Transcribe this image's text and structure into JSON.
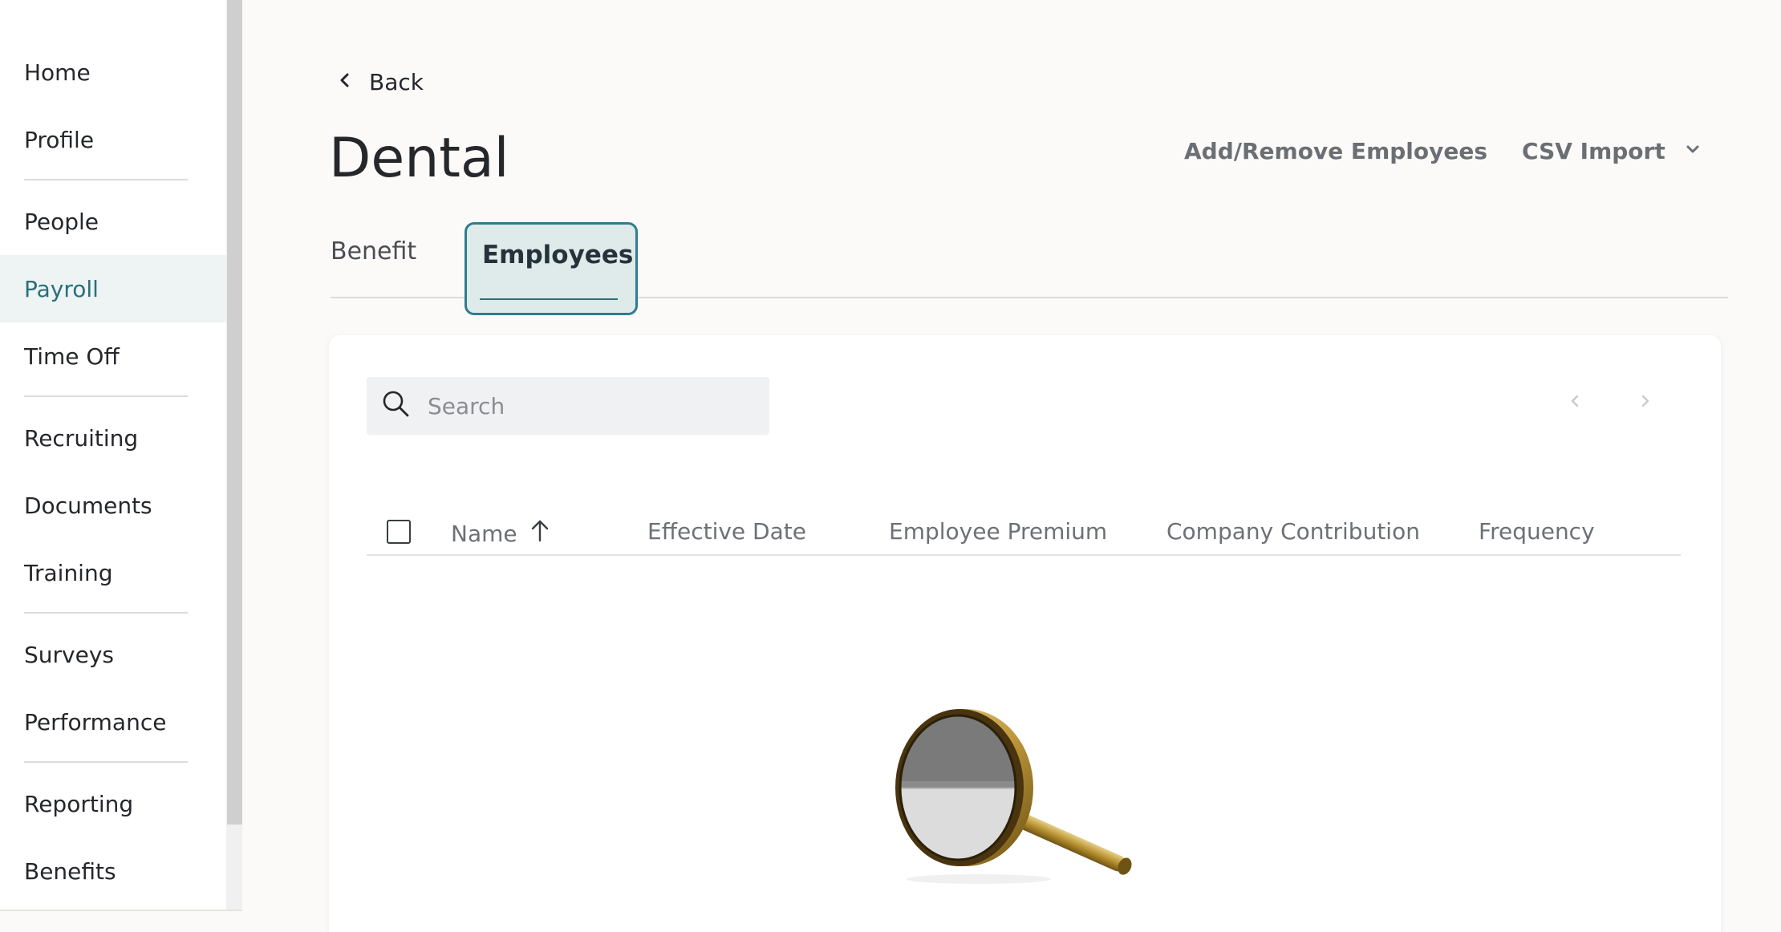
{
  "sidebar": {
    "items": [
      {
        "label": "Home"
      },
      {
        "label": "Profile"
      },
      {
        "label": "People"
      },
      {
        "label": "Payroll"
      },
      {
        "label": "Time Off"
      },
      {
        "label": "Recruiting"
      },
      {
        "label": "Documents"
      },
      {
        "label": "Training"
      },
      {
        "label": "Surveys"
      },
      {
        "label": "Performance"
      },
      {
        "label": "Reporting"
      },
      {
        "label": "Benefits"
      }
    ],
    "active_item": "Payroll"
  },
  "header": {
    "back_label": "Back",
    "title": "Dental",
    "add_remove_label": "Add/Remove Employees",
    "csv_import_label": "CSV Import"
  },
  "tabs": [
    {
      "label": "Benefit"
    },
    {
      "label": "Employees"
    }
  ],
  "active_tab": "Employees",
  "search": {
    "placeholder": "Search",
    "value": ""
  },
  "table": {
    "columns": [
      {
        "label": "Name",
        "sort": "ascending"
      },
      {
        "label": "Effective Date"
      },
      {
        "label": "Employee Premium"
      },
      {
        "label": "Company Contribution"
      },
      {
        "label": "Frequency"
      }
    ],
    "rows": []
  },
  "icons": {
    "back": "chevron-left-icon",
    "dropdown": "chevron-down-icon",
    "search": "search-icon",
    "sort": "arrow-up-icon",
    "prev_page": "chevron-left-icon",
    "next_page": "chevron-right-icon",
    "empty_state": "magnifying-glass-illustration"
  },
  "colors": {
    "accent": "#2f7d8c",
    "active_nav_bg": "#eef3f3",
    "active_nav_text": "#2a6f7a",
    "page_bg": "#fbfaf9"
  }
}
